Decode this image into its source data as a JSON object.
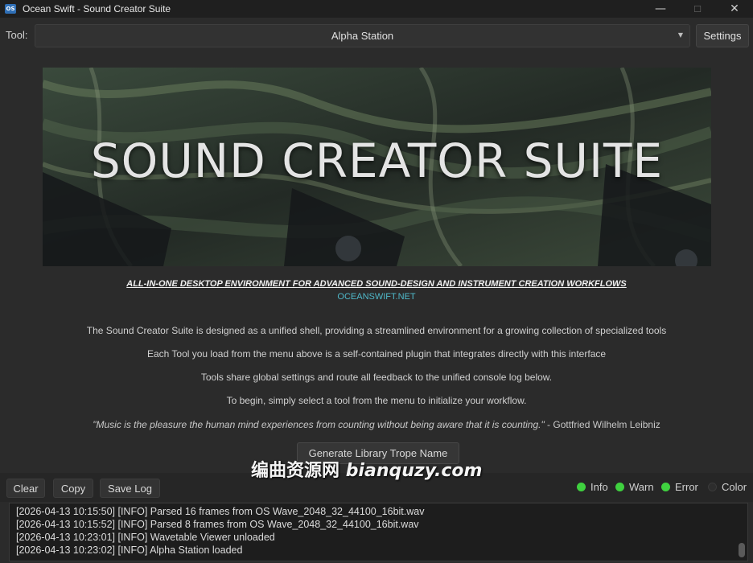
{
  "window": {
    "icon_text": "OS",
    "title": "Ocean Swift - Sound Creator Suite",
    "controls": {
      "minimize": "—",
      "maximize": "☐",
      "close": "✕"
    }
  },
  "toolbar": {
    "tool_label": "Tool:",
    "selected_tool": "Alpha Station",
    "dropdown_icon": "▼",
    "settings_label": "Settings"
  },
  "banner": {
    "title": "SOUND CREATOR SUITE"
  },
  "intro": {
    "tagline": "ALL-IN-ONE DESKTOP ENVIRONMENT FOR ADVANCED SOUND-DESIGN AND INSTRUMENT CREATION WORKFLOWS",
    "site": "OCEANSWIFT.NET",
    "paragraphs": [
      "The Sound Creator Suite is designed as a unified shell, providing a streamlined environment for a growing collection of specialized tools",
      "Each Tool you load from the menu above is a self-contained plugin that integrates directly with this interface",
      "Tools share global settings and route all feedback to the unified console log below.",
      "To begin, simply select a tool from the menu to initialize your workflow."
    ],
    "quote": "\"Music is the pleasure the human mind experiences from counting without being aware that it is counting.\"",
    "quote_author": " - Gottfried Wilhelm Leibniz",
    "generate_button": "Generate Library Trope Name"
  },
  "watermark": {
    "cjk": "编曲资源网",
    "latin": "bianquzy.com"
  },
  "log_controls": {
    "clear": "Clear",
    "copy": "Copy",
    "save_log": "Save Log",
    "filters": [
      {
        "label": "Info",
        "color": "#3fd13f",
        "active": true
      },
      {
        "label": "Warn",
        "color": "#3fd13f",
        "active": true
      },
      {
        "label": "Error",
        "color": "#3fd13f",
        "active": true
      },
      {
        "label": "Color",
        "color": "#2d2d2d",
        "active": false
      }
    ]
  },
  "console": {
    "lines": [
      "[2026-04-13 10:15:50] [INFO] Parsed 16 frames from OS Wave_2048_32_44100_16bit.wav",
      "[2026-04-13 10:15:52] [INFO] Parsed 8 frames from OS Wave_2048_32_44100_16bit.wav",
      "[2026-04-13 10:23:01] [INFO] Wavetable Viewer unloaded",
      "[2026-04-13 10:23:02] [INFO] Alpha Station loaded"
    ]
  }
}
